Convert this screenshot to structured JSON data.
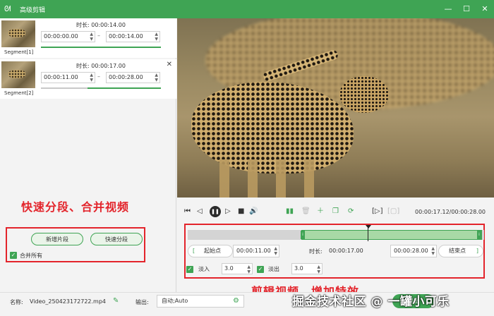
{
  "window": {
    "title": "高级剪辑",
    "logo_icon": "rabbit-logo-icon",
    "accent": "#3fa454"
  },
  "segments": [
    {
      "label": "Segment[1]",
      "duration": "时长: 00:00:14.00",
      "start": "00:00:00.00",
      "end": "00:00:14.00"
    },
    {
      "label": "Segment[2]",
      "duration": "时长: 00:00:17.00",
      "start": "00:00:11.00",
      "end": "00:00:28.00"
    }
  ],
  "left_actions": {
    "add_segment": "新增片段",
    "quick_split": "快速分段",
    "merge_all": "合并所有",
    "merge_all_checked": true
  },
  "annotations": {
    "left": "快速分段、合并视频",
    "right": "剪辑视频、增加特效"
  },
  "player": {
    "time_readout": "00:00:17.12/00:00:28.00",
    "timeline_selection_start": 0.39,
    "timeline_selection_end": 1.0,
    "playhead": 0.61
  },
  "range": {
    "start_btn": "起始点",
    "start_value": "00:00:11.00",
    "duration_label": "时长:",
    "duration_value": "00:00:17.00",
    "end_value": "00:00:28.00",
    "end_btn": "结束点"
  },
  "effects": {
    "fade_in_label": "淡入",
    "fade_in_value": "3.0",
    "fade_out_label": "淡出",
    "fade_out_value": "3.0"
  },
  "bottom": {
    "name_label": "名称:",
    "name_value": "Video_250423172722.mp4",
    "output_label": "输出:",
    "output_value": "自动;Auto",
    "export_label": "导出"
  },
  "watermark": "掘金技术社区 @ 一罐小可乐"
}
